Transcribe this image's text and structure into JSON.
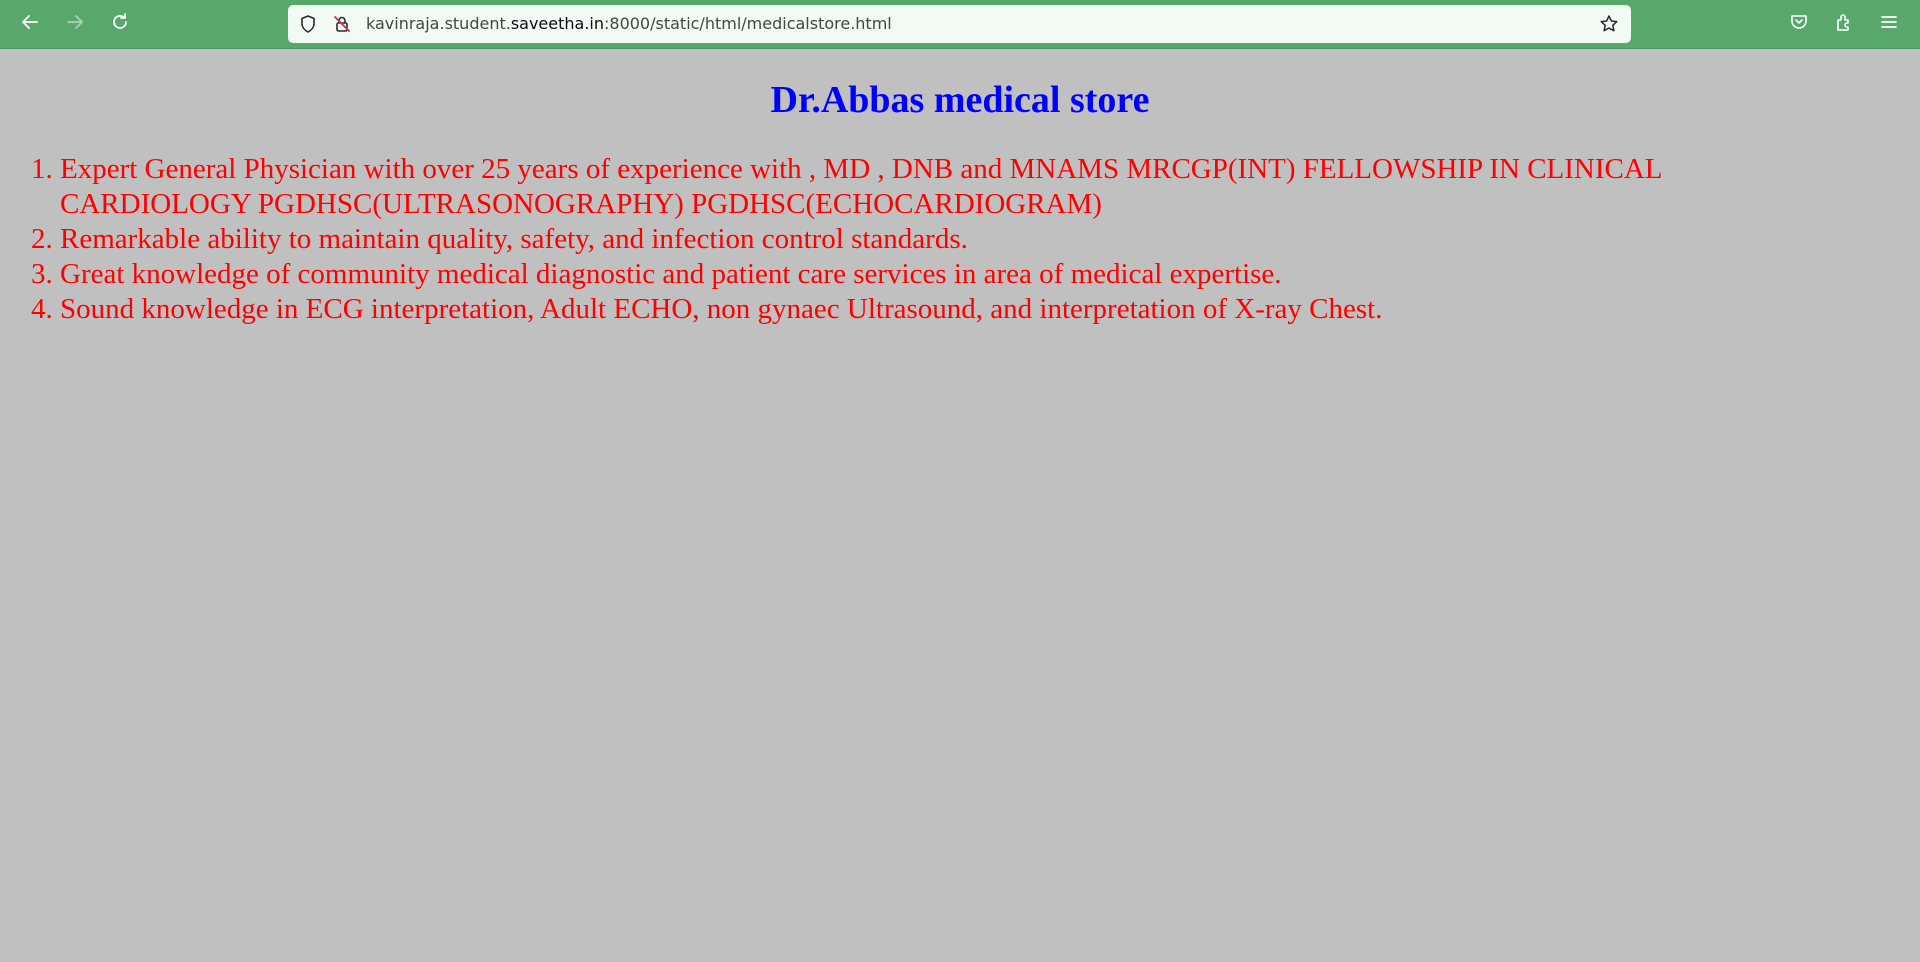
{
  "browser": {
    "url_prefix": "kavinraja.student.",
    "url_domain": "saveetha.in",
    "url_suffix": ":8000/static/html/medicalstore.html",
    "icons": {
      "back": "back-arrow-icon",
      "forward": "forward-arrow-icon",
      "reload": "reload-icon",
      "shield": "tracking-shield-icon",
      "insecure": "insecure-connection-icon",
      "bookmark": "bookmark-star-icon",
      "pocket": "pocket-icon",
      "extensions": "extensions-icon",
      "menu": "hamburger-menu-icon"
    }
  },
  "page": {
    "title": "Dr.Abbas medical store",
    "title_color": "#0000ff",
    "text_color": "#ff0000",
    "background": "#c0c0c0",
    "items": [
      "Expert General Physician with over 25 years of experience with , MD , DNB and MNAMS MRCGP(INT) FELLOWSHIP IN CLINICAL CARDIOLOGY PGDHSC(ULTRASONOGRAPHY) PGDHSC(ECHOCARDIOGRAM)",
      "Remarkable ability to maintain quality, safety, and infection control standards.",
      "Great knowledge of community medical diagnostic and patient care services in area of medical expertise.",
      "Sound knowledge in ECG interpretation, Adult ECHO, non gynaec Ultrasound, and interpretation of X-ray Chest."
    ]
  }
}
